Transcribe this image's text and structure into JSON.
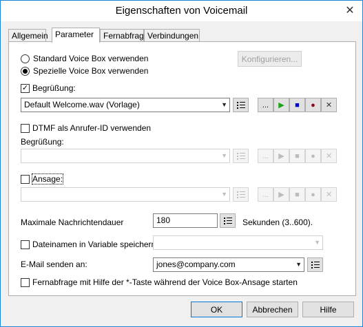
{
  "window": {
    "title": "Eigenschaften von Voicemail",
    "close_glyph": "✕"
  },
  "tabs": [
    {
      "label": "Allgemein"
    },
    {
      "label": "Parameter"
    },
    {
      "label": "Fernabfrage"
    },
    {
      "label": "Verbindungen"
    }
  ],
  "active_tab": "Parameter",
  "voicebox": {
    "standard_label": "Standard Voice Box  verwenden",
    "special_label": "Spezielle Voice Box  verwenden",
    "selected": "special",
    "configure_label": "Konfigurieren..."
  },
  "greeting": {
    "checkbox_label": "Begrüßung:",
    "checked": true,
    "value": "Default Welcome.wav (Vorlage)",
    "browse_label": "...",
    "play_icon": "▶",
    "stop_icon": "■",
    "record_icon": "●",
    "delete_icon": "✕"
  },
  "dtmf": {
    "checkbox_label": "DTMF als Anrufer-ID verwenden",
    "checked": false,
    "greeting_label": "Begrüßung:",
    "value": ""
  },
  "announcement": {
    "checkbox_label": "Ansage:",
    "checked": false,
    "value": ""
  },
  "max_duration": {
    "label": "Maximale Nachrichtendauer",
    "value": "180",
    "unit": "Sekunden (3..600)."
  },
  "filename_var": {
    "checkbox_label": "Dateinamen in Variable speichern:",
    "checked": false,
    "value": ""
  },
  "email": {
    "label": "E-Mail senden an:",
    "value": "jones@company.com"
  },
  "remote": {
    "checkbox_label": "Fernabfrage mit Hilfe der *-Taste während der Voice Box-Ansage starten",
    "checked": false
  },
  "footer": {
    "ok": "OK",
    "cancel": "Abbrechen",
    "help": "Hilfe"
  },
  "colors": {
    "play": "#1aa31a",
    "stop": "#0000e0",
    "record": "#8b0a1a",
    "accent": "#0078d7"
  }
}
